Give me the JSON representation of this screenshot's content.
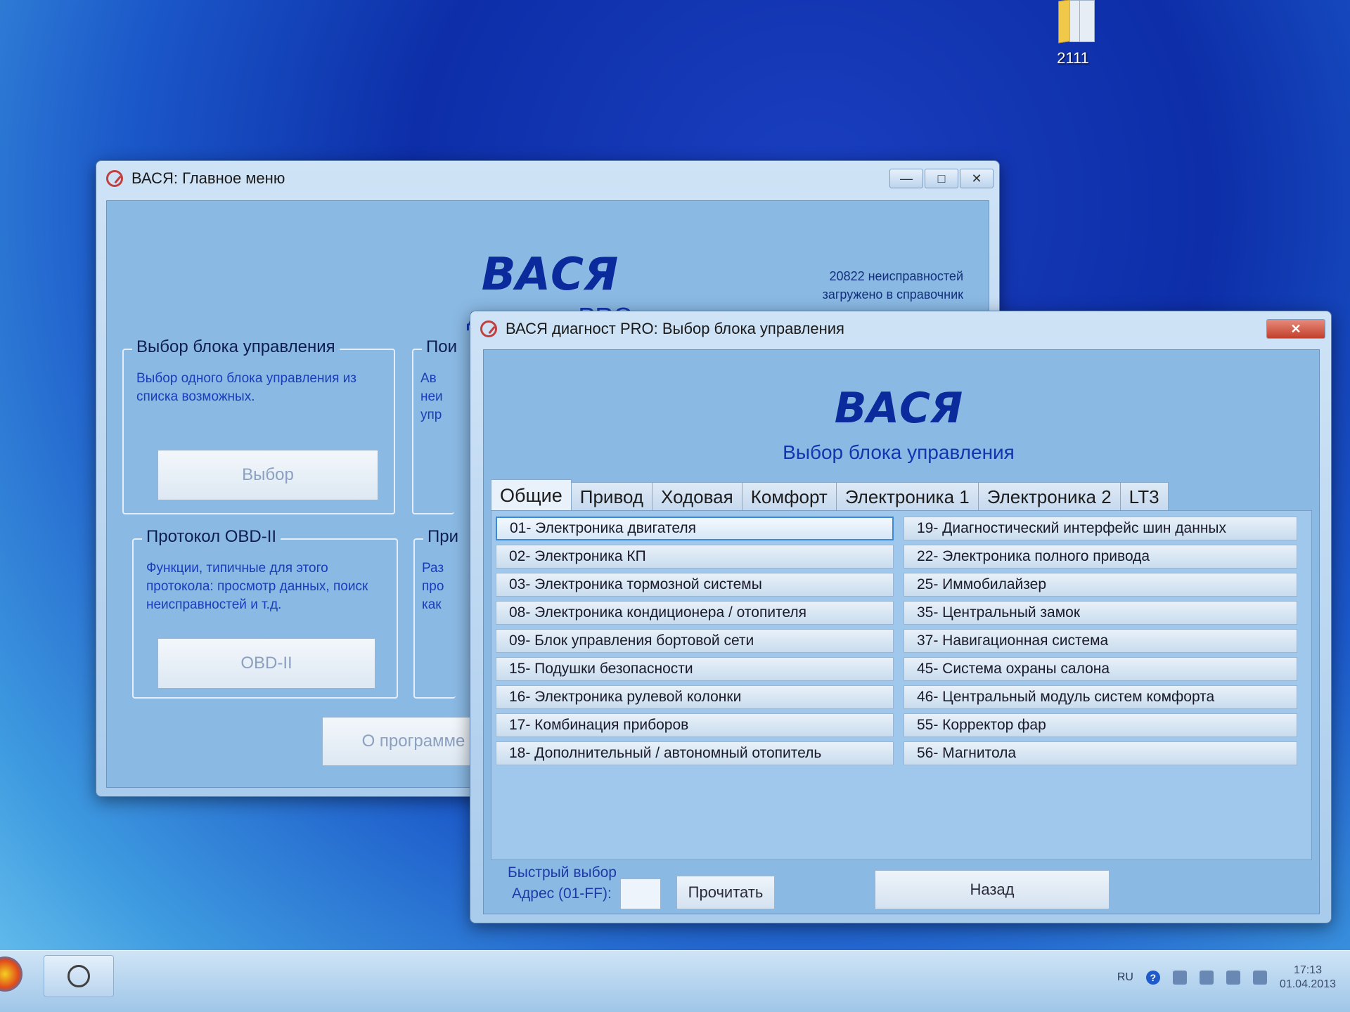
{
  "desktop": {
    "icon_label": "2111"
  },
  "main_window": {
    "title": "ВАСЯ:  Главное меню",
    "brand": "ВАСЯ",
    "subtitle": "диагност PRO",
    "faults_line1": "20822 неисправностей",
    "faults_line2": "загружено в справочник",
    "group_select": {
      "legend": "Выбор блока управления",
      "desc": "Выбор одного блока управления из списка возможных.",
      "button": "Выбор"
    },
    "group_search": {
      "legend": "Пои",
      "desc_l1": "Ав",
      "desc_l2": "неи",
      "desc_l3": "упр"
    },
    "group_obd": {
      "legend": "Протокол OBD-II",
      "desc": "Функции, типичные для этого протокола: просмотр данных, поиск неисправностей и т.д.",
      "button": "OBD-II"
    },
    "group_other": {
      "legend": "При",
      "desc_l1": "Раз",
      "desc_l2": "про",
      "desc_l3": "как"
    },
    "about_button": "О программе"
  },
  "dialog": {
    "title": "ВАСЯ диагност PRO:  Выбор блока управления",
    "brand": "ВАСЯ",
    "subtitle": "Выбор блока управления",
    "tabs": [
      "Общие",
      "Привод",
      "Ходовая",
      "Комфорт",
      "Электроника 1",
      "Электроника 2",
      "LT3"
    ],
    "active_tab": "Общие",
    "left_list": [
      "01- Электроника двигателя",
      "02- Электроника КП",
      "03- Электроника тормозной системы",
      "08- Электроника кондиционера / отопителя",
      "09- Блок управления бортовой сети",
      "15- Подушки безопасности",
      "16- Электроника рулевой колонки",
      "17- Комбинация приборов",
      "18- Дополнительный / автономный отопитель"
    ],
    "right_list": [
      "19- Диагностический интерфейс шин данных",
      "22- Электроника полного привода",
      "25- Иммобилайзер",
      "35- Центральный замок",
      "37- Навигационная система",
      "45- Система охраны салона",
      "46- Центральный модуль систем комфорта",
      "55- Корректор фар",
      "56- Магнитола"
    ],
    "selected_item": "01- Электроника двигателя",
    "quick_title": "Быстрый выбор",
    "address_label": "Адрес (01-FF):",
    "address_value": "",
    "read_button": "Прочитать",
    "back_button": "Назад"
  },
  "taskbar": {
    "lang": "RU",
    "time": "17:13",
    "date": "01.04.2013"
  }
}
